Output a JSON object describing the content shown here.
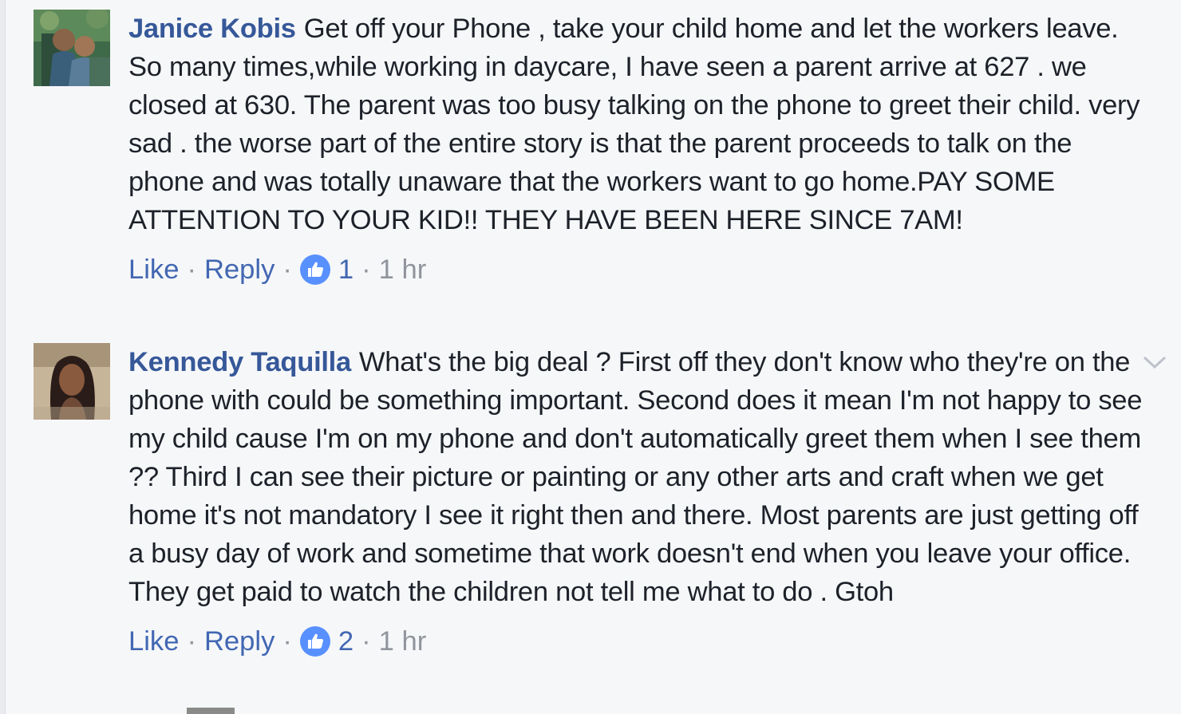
{
  "comments": [
    {
      "author": "Janice Kobis",
      "text": "Get off your Phone , take your child home and let the workers leave. So many times,while working in daycare, I have seen a parent arrive at 627 . we closed at 630. The parent was too busy talking on the phone to greet their child. very sad . the worse part of the entire story is that the parent proceeds to talk on the phone and was totally unaware that the workers want to go home.PAY SOME ATTENTION TO YOUR KID!! THEY HAVE BEEN HERE SINCE 7AM!",
      "like_label": "Like",
      "reply_label": "Reply",
      "like_count": "1",
      "time": "1 hr",
      "avatar_icon": "profile-photo"
    },
    {
      "author": "Kennedy Taquilla",
      "text": "What's the big deal ? First off they don't know who they're on the phone with could be something important. Second does it mean I'm not happy to see my child cause I'm on my phone and don't automatically greet them when I see them ?? Third I can see their picture or painting or any other arts and craft when we get home it's not mandatory I see it right then and there. Most parents are just getting off a busy day of work and sometime that work doesn't end when you leave your office. They get paid to watch the children not tell me what to do . Gtoh",
      "like_label": "Like",
      "reply_label": "Reply",
      "like_count": "2",
      "time": "1 hr",
      "avatar_icon": "profile-photo"
    }
  ],
  "separator": "·",
  "colors": {
    "author": "#365899",
    "link": "#4267b2",
    "meta": "#90949c",
    "background": "#f6f7f9"
  }
}
